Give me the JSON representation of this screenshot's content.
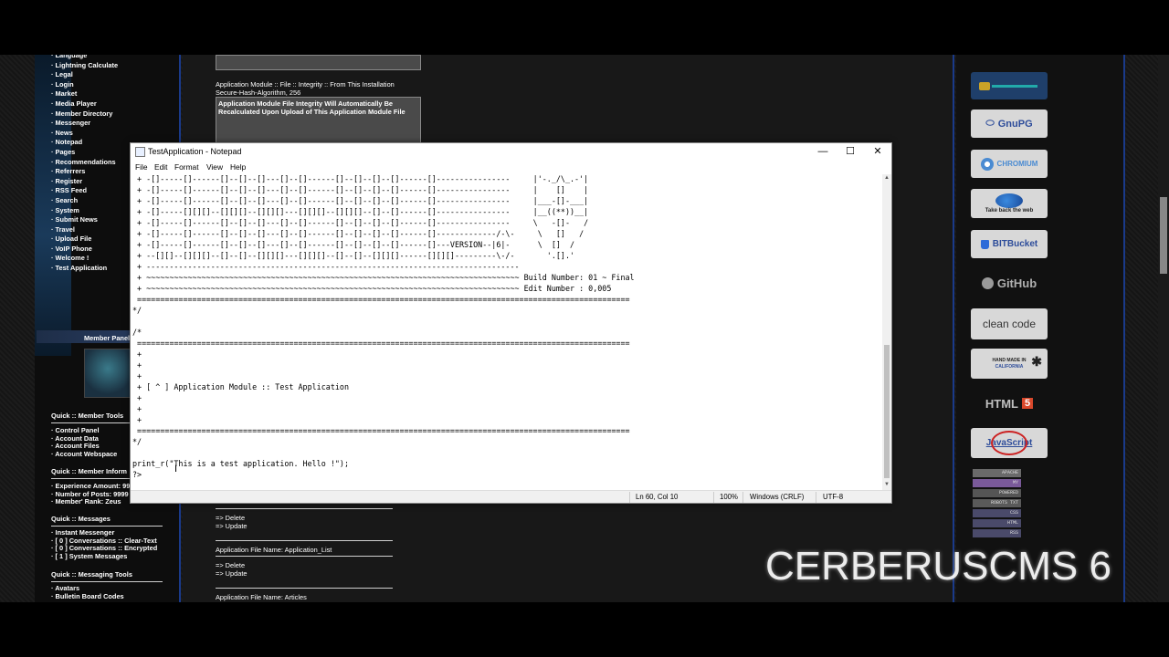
{
  "site": {
    "left_menu": [
      "Language",
      "Lightning Calculate",
      "Legal",
      "Login",
      "Market",
      "Media Player",
      "Member Directory",
      "Messenger",
      "News",
      "Notepad",
      "Pages",
      "Recommendations",
      "Referrers",
      "Register",
      "RSS Feed",
      "Search",
      "System",
      "Submit News",
      "Travel",
      "Upload File",
      "VoIP Phone",
      "Welcome !",
      "Test Application"
    ],
    "member_panel": "Member Panel",
    "member_tools_title": "Quick :: Member Tools",
    "member_tools": [
      "Control Panel",
      "Account Data",
      "Account Files",
      "Account Webspace"
    ],
    "member_info_title": "Quick :: Member Inform",
    "member_info": [
      "Experience Amount: 99",
      "Number of Posts: 9999",
      "Member' Rank: Zeus"
    ],
    "messages_title": "Quick :: Messages",
    "messages": [
      "Instant Messenger",
      "[ 0 ] Conversations :: Clear-Text",
      "[ 0 ] Conversations :: Encrypted",
      "[ 1 ] System Messages"
    ],
    "messaging_tools_title": "Quick :: Messaging Tools",
    "messaging_tools": [
      "Avatars",
      "Bulletin Board Codes"
    ],
    "middle": {
      "integrity_label": "Application Module :: File :: Integrity :: From This Installation",
      "integrity_algo": "Secure-Hash-Algorithm, 256",
      "integrity_note": "Application Module File Integrity Will Automatically Be Recalculated Upon Upload of This Application Module File",
      "delete1": "=> Delete",
      "update1": "=> Update",
      "file1": "Application File Name: Application_List",
      "delete2": "=> Delete",
      "update2": "=> Update",
      "file2": "Application File Name: Articles"
    },
    "badges": {
      "gnupg": "GnuPG",
      "chromium": "CHROMIUM",
      "wayback": "Take back the web",
      "bitbucket": "BITBucket",
      "github": "GitHub",
      "cleancode": "clean code",
      "handmade": "HAND MADE IN",
      "california": "CALIFORNIA",
      "html5": "HTML",
      "html5_num": "5",
      "javascript": "JavaScript"
    },
    "mini_badges": [
      "APACHE",
      "MY",
      "POWERED",
      "ROBOTS TXT",
      "CSS",
      "HTML",
      "RSS"
    ],
    "brand": "CERBERUSCMS 6"
  },
  "notepad": {
    "title": "TestApplication - Notepad",
    "menu": [
      "File",
      "Edit",
      "Format",
      "View",
      "Help"
    ],
    "window_buttons": {
      "minimize": "—",
      "maximize": "☐",
      "close": "✕"
    },
    "lines": [
      " + -[]-----[]------[]--[]--[]---[]--[]------[]--[]--[]--[]------[]----------------     |'-._/\\_.-'|",
      " + -[]-----[]------[]--[]--[]---[]--[]------[]--[]--[]--[]------[]----------------     |    []    |",
      " + -[]-----[]------[]--[]--[]---[]--[]------[]--[]--[]--[]------[]----------------     |___-[]-___|",
      " + -[]-----[][][]--[][][]--[][][]---[][][]--[][][]--[]--[]------[]----------------     |__((**))__|",
      " + -[]-----[]------[]--[]--[]---[]--[]------[]--[]--[]--[]------[]----------------     \\   -[]-   /",
      " + -[]-----[]------[]--[]--[]---[]--[]------[]--[]--[]--[]------[]-------------/-\\-     \\   []   /",
      " + -[]-----[]------[]--[]--[]---[]--[]------[]--[]--[]--[]------[]---VERSION--|6|-      \\  []  /",
      " + --[][]--[][][]--[]--[]--[][][]---[][][]--[]--[]--[][][]------[][][]---------\\-/-       '.[].'",
      " + ---------------------------------------------------------------------------------",
      " + ~~~~~~~~~~~~~~~~~~~~~~~~~~~~~~~~~~~~~~~~~~~~~~~~~~~~~~~~~~~~~~~~~~~~~~~~~~~~~~~~~ Build Number: 01 ~ Final",
      " + ~~~~~~~~~~~~~~~~~~~~~~~~~~~~~~~~~~~~~~~~~~~~~~~~~~~~~~~~~~~~~~~~~~~~~~~~~~~~~~~~~ Edit Number : 0,005",
      " ===========================================================================================================",
      "*/",
      "",
      "/*",
      " ===========================================================================================================",
      " +",
      " +",
      " +",
      " + [ ^ ] Application Module :: Test Application",
      " +",
      " +",
      " +",
      " ===========================================================================================================",
      "*/",
      "",
      "print_r(\"This is a test application. Hello !\");",
      "?>"
    ],
    "status": {
      "position": "Ln 60, Col 10",
      "zoom": "100%",
      "line_ending": "Windows (CRLF)",
      "encoding": "UTF-8"
    }
  }
}
